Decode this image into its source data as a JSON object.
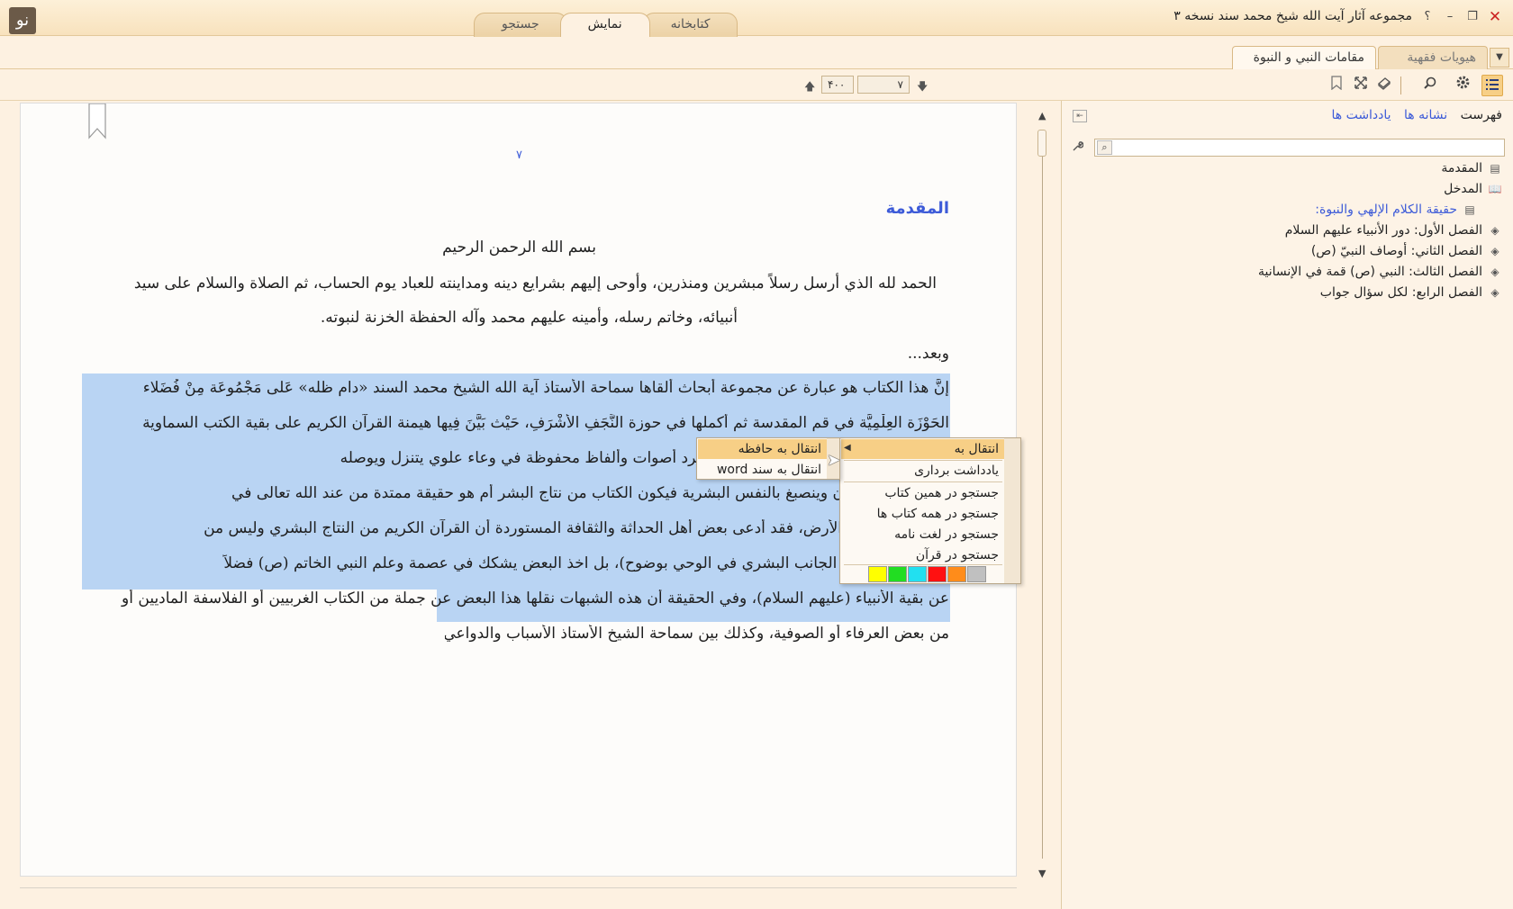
{
  "window": {
    "title": "مجموعه آثار آیت الله شیخ محمد سند نسخه ۳",
    "help_label": "؟",
    "minimize_label": "–",
    "restore_label": "❐",
    "close_label": "✕",
    "logo_glyph": "نو"
  },
  "main_tabs": [
    "کتابخانه",
    "نمایش",
    "جستجو"
  ],
  "doc_tabs": {
    "inactive": "هیویات فقهیة",
    "current": "مقامات النبي و النبوة",
    "close": "×",
    "dropdown": "▼"
  },
  "toolbar": {
    "page_current": "۷",
    "page_total": "۴۰۰",
    "prev_arrow": "🡅",
    "next_arrow": "🡇"
  },
  "reader": {
    "page_number": "۷",
    "heading": "المقدمة",
    "lines": [
      "بسم الله الرحمن الرحيم",
      "الحمد لله الذي أرسل رسلاً مبشرين ومنذرين، وأوحى إليهم بشرايع دينه ومداينته للعباد يوم الحساب، ثم الصلاة والسلام على سيد",
      "أنبيائه، وخاتم رسله، وأمينه عليهم محمد وآله الحفظة الخزنة لنبوته.",
      "وبعد..."
    ],
    "selected_lines": [
      "إنَّ هذا الكتاب هو عبارة عن مجموعة أبحاث ألقاها سماحة الأُستاذ آية الله الشيخ محمد السند «دام ظله» عَلى مَجْمُوعَة مِنْ فُضَلاء",
      "الحَوْزَة العِلْمِيَّة في قم المقدسة ثم أكملها في حوزة النَّجَفِ الأَشْرَفِ، حَيْث بَيَّنَ فِيها هيمنة القرآن الكريم على بقية الكتب السماوية",
      "على جميع الأنبياء، وهل أن القرآن هو مجرد أصوات وألفاظ محفوظة في وعاء علوي يتنزل ويوصله",
      "البشر، أو أنه يتلون وينصبغ بالنفس البشرية فيكون الكتاب من نتاج البشر أم هو حقيقة ممتدة من عند الله تعالى في",
      "سلسلة تنزلاً إلى الأرض، فقد أدعى بعض أهل الحداثة والثقافة المستوردة أن القرآن الكريم من النتاج البشري وليس من",
      "مثلاً (... مما يثبت الجانب البشري في الوحي بوضوح)، بل اخذ البعض يشكك في عصمة وعلم النبي الخاتم (ص) فضلاً",
      "عن بقية الأنبياء (عليهم السلام)، وفي الحقيقة أن هذه الشبهات نقلها هذا البعض عن جملة من الكتاب الغربيين أو الفلاسفة الماديين أو",
      "من بعض العرفاء أو الصوفية، وكذلك بين سماحة الشيخ الأستاذ الأسباب والدواعي"
    ]
  },
  "sidebar": {
    "tabs": [
      "فهرست",
      "نشانه ها",
      "یادداشت ها"
    ],
    "search_placeholder": "",
    "toc": [
      {
        "label": "المقدمة",
        "icon": "page-icon",
        "sub": false
      },
      {
        "label": "المدخل",
        "icon": "book-open-icon",
        "sub": false
      },
      {
        "label": "حقيقة الكلام الإلهي والنبوة:",
        "icon": "page-icon",
        "sub": true
      },
      {
        "label": "الفصل الأول: دور الأنبياء عليهم السلام",
        "icon": "book-icon",
        "sub": false
      },
      {
        "label": "الفصل الثاني: أوصاف النبيّ (ص)",
        "icon": "book-icon",
        "sub": false
      },
      {
        "label": "الفصل الثالث: النبي (ص) قمة في الإنسانية",
        "icon": "book-icon",
        "sub": false
      },
      {
        "label": "الفصل الرابع: لكل سؤال جواب",
        "icon": "book-icon",
        "sub": false
      }
    ]
  },
  "context_menu": {
    "items": [
      "انتقال به",
      "یادداشت برداری",
      "جستجو در همین کتاب",
      "جستجو در همه کتاب ها",
      "جستجو در لغت نامه",
      "جستجو در قرآن"
    ],
    "submenu": [
      "انتقال به حافظه",
      "انتقال به سند word"
    ],
    "highlight_colors": [
      "#ffff00",
      "#22dd22",
      "#22e0f0",
      "#ff1111",
      "#ff8c1a",
      "#c0c0c0"
    ]
  }
}
